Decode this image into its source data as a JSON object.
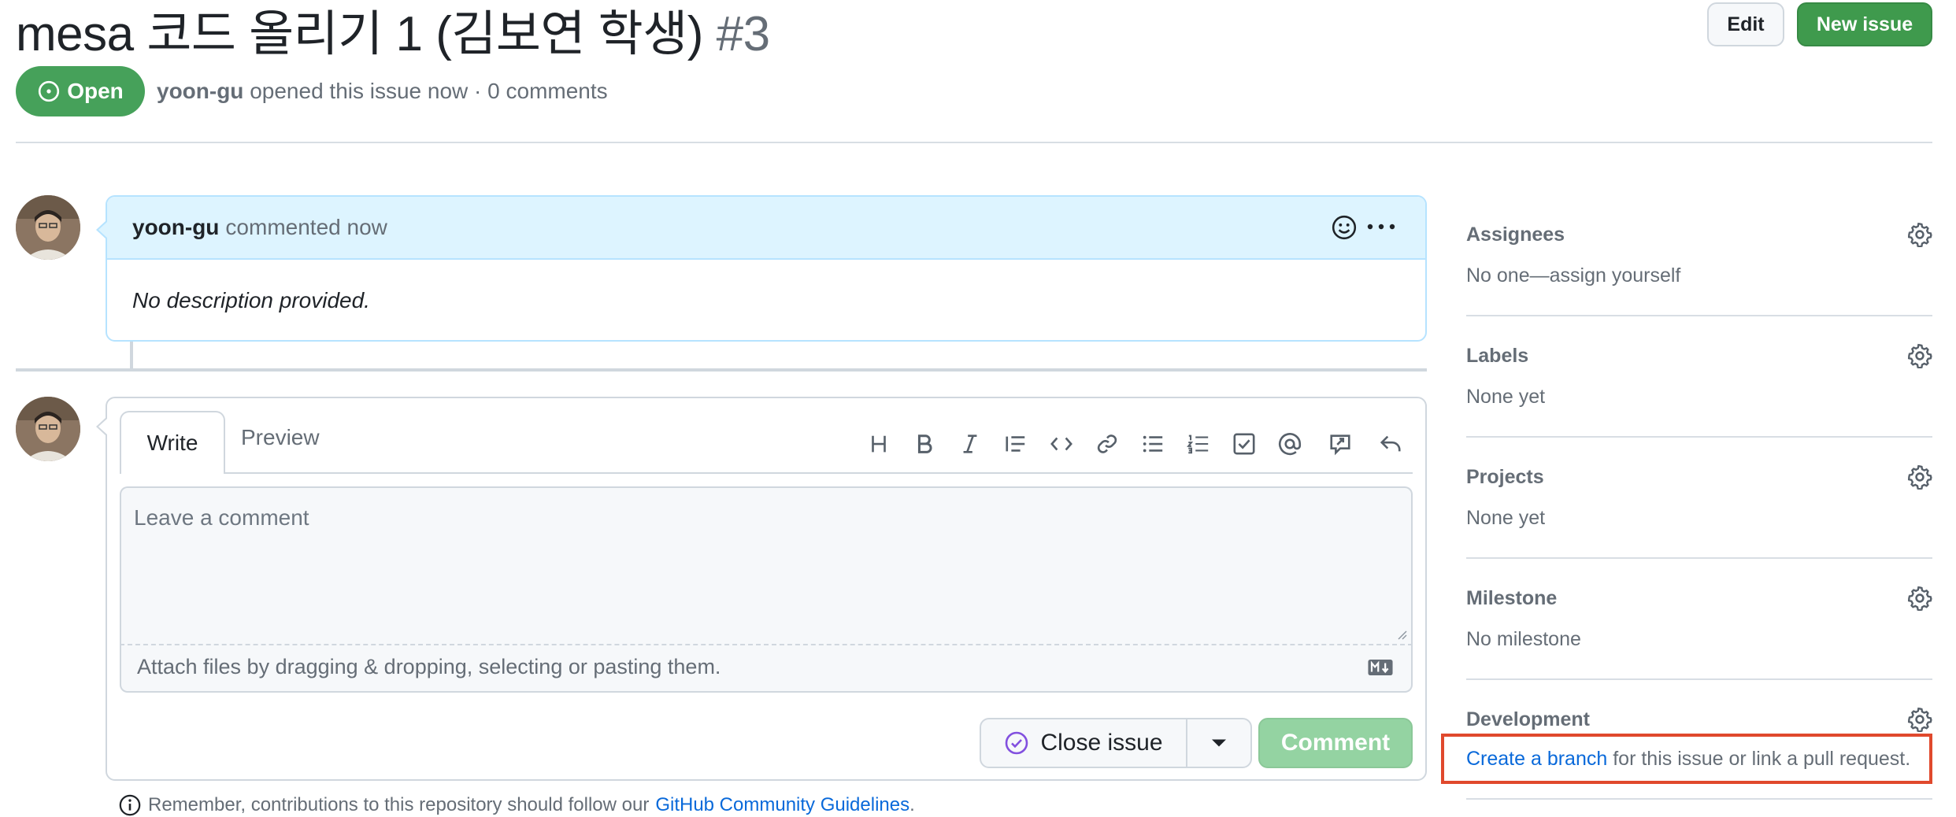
{
  "issue": {
    "title": "mesa 코드 올리기 1 (김보연 학생)",
    "number": "#3",
    "state": "Open",
    "author": "yoon-gu",
    "meta_rest": "opened this issue now · 0 comments"
  },
  "header_buttons": {
    "edit": "Edit",
    "new_issue": "New issue"
  },
  "comment": {
    "author": "yoon-gu",
    "action": "commented now",
    "body": "No description provided."
  },
  "editor": {
    "tabs": [
      "Write",
      "Preview"
    ],
    "placeholder": "Leave a comment",
    "attach_hint": "Attach files by dragging & dropping, selecting or pasting them.",
    "toolbar_icons": [
      "heading-icon",
      "bold-icon",
      "italic-icon",
      "quote-icon",
      "code-icon",
      "link-icon",
      "bullet-list-icon",
      "numbered-list-icon",
      "task-list-icon",
      "mention-icon",
      "reference-icon",
      "reply-icon"
    ]
  },
  "actions": {
    "close": "Close issue",
    "comment": "Comment"
  },
  "footer": {
    "prefix": "Remember, contributions to this repository should follow our",
    "link": "GitHub Community Guidelines",
    "suffix": "."
  },
  "sidebar": {
    "assignees": {
      "title": "Assignees",
      "value": "No one—assign yourself"
    },
    "labels": {
      "title": "Labels",
      "value": "None yet"
    },
    "projects": {
      "title": "Projects",
      "value": "None yet"
    },
    "milestone": {
      "title": "Milestone",
      "value": "No milestone"
    },
    "development": {
      "title": "Development",
      "link": "Create a branch",
      "rest": "for this issue or link a pull request."
    }
  },
  "colors": {
    "open": "#46a15a",
    "primary": "#3f9a4d",
    "link": "#0969da",
    "highlight": "#e0492d"
  }
}
